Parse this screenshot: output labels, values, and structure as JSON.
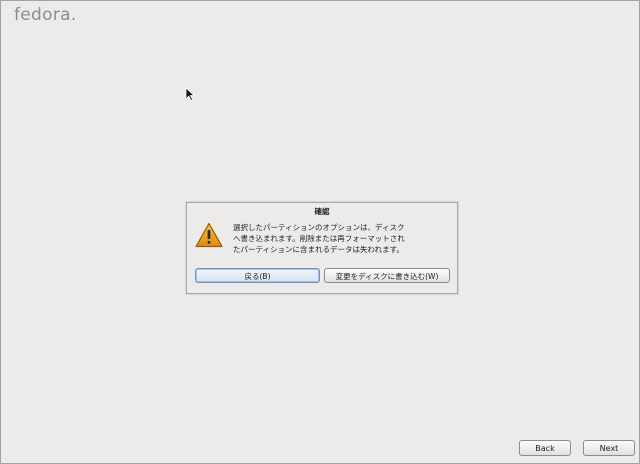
{
  "brand": {
    "logo_text": "fedora."
  },
  "dialog": {
    "title": "確認",
    "icon": "warning-triangle-icon",
    "message_lines": [
      "選択したパーティションのオプションは、ディスク",
      "へ書き込まれます。削除または再フォーマットされ",
      "たパーティションに含まれるデータは失われます。"
    ],
    "back_label": "戻る(B)",
    "write_label": "変更をディスクに書き込む(W)"
  },
  "nav": {
    "back_label": "Back",
    "next_label": "Next"
  },
  "colors": {
    "background": "#ecebe9",
    "warning": "#e8a20c",
    "focus": "#6f92c1"
  }
}
